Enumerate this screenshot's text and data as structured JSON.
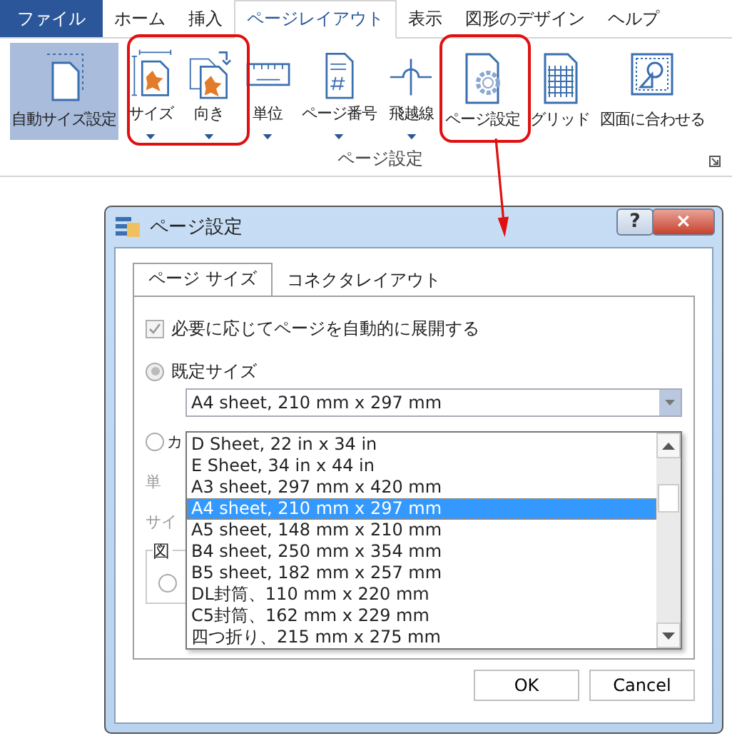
{
  "ribbon": {
    "tabs": [
      {
        "label": "ファイル",
        "kind": "file",
        "selected": false
      },
      {
        "label": "ホーム",
        "kind": "tab",
        "selected": false
      },
      {
        "label": "挿入",
        "kind": "tab",
        "selected": false
      },
      {
        "label": "ページレイアウト",
        "kind": "tab",
        "selected": true
      },
      {
        "label": "表示",
        "kind": "tab",
        "selected": false
      },
      {
        "label": "図形のデザイン",
        "kind": "tab",
        "selected": false
      },
      {
        "label": "ヘルプ",
        "kind": "tab",
        "selected": false
      }
    ],
    "buttons": [
      {
        "label": "自動サイズ設定",
        "kind": "autosize",
        "on": true,
        "dropdown": false
      },
      {
        "label": "サイズ",
        "kind": "size",
        "on": false,
        "dropdown": true
      },
      {
        "label": "向き",
        "kind": "orientation",
        "on": false,
        "dropdown": true
      },
      {
        "label": "単位",
        "kind": "units",
        "on": false,
        "dropdown": true
      },
      {
        "label": "ページ番号",
        "kind": "pagenumber",
        "on": false,
        "dropdown": true
      },
      {
        "label": "飛越線",
        "kind": "jumpline",
        "on": false,
        "dropdown": true
      },
      {
        "label": "ページ設定",
        "kind": "pagesetup",
        "on": false,
        "dropdown": false
      },
      {
        "label": "グリッド",
        "kind": "grid",
        "on": false,
        "dropdown": false
      },
      {
        "label": "図面に合わせる",
        "kind": "fit",
        "on": false,
        "dropdown": false
      }
    ],
    "group_label": "ページ設定"
  },
  "dialog": {
    "title": "ページ設定",
    "help": "?",
    "close": "×",
    "tabs": [
      {
        "label": "ページ サイズ",
        "selected": true
      },
      {
        "label": "コネクタレイアウト",
        "selected": false
      }
    ],
    "auto_expand": {
      "label": "必要に応じてページを自動的に展開する",
      "checked": true,
      "disabled": true
    },
    "preset": {
      "label": "既定サイズ",
      "selected": true,
      "disabled": true
    },
    "combo_value": "A4 sheet, 210 mm x 297 mm",
    "options": [
      {
        "label": "D Sheet, 22 in x 34 in",
        "selected": false
      },
      {
        "label": "E Sheet, 34 in x 44 in",
        "selected": false
      },
      {
        "label": "A3 sheet, 297 mm x 420 mm",
        "selected": false
      },
      {
        "label": "A4 sheet, 210 mm x 297 mm",
        "selected": true
      },
      {
        "label": "A5 sheet, 148 mm x 210 mm",
        "selected": false
      },
      {
        "label": "B4 sheet, 250 mm x 354 mm",
        "selected": false
      },
      {
        "label": "B5 sheet, 182 mm x 257 mm",
        "selected": false
      },
      {
        "label": "DL封筒、110 mm x 220 mm",
        "selected": false
      },
      {
        "label": "C5封筒、162 mm x 229 mm",
        "selected": false
      },
      {
        "label": "四つ折り、215 mm x 275 mm",
        "selected": false
      }
    ],
    "custom": {
      "label": "カ",
      "selected": false
    },
    "units_label": "単",
    "size_label": "サイ",
    "group_title": "図",
    "group_radio_selected": false,
    "buttons": [
      "OK",
      "Cancel"
    ]
  }
}
